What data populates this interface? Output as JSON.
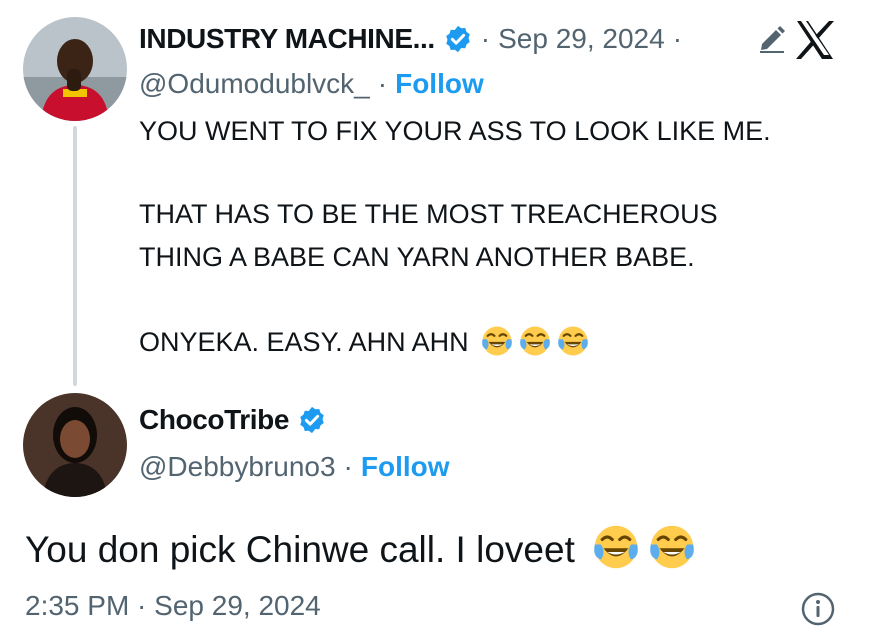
{
  "tweet1": {
    "author_name": "INDUSTRY MACHINE...",
    "handle": "@Odumodublvck_",
    "follow_label": "Follow",
    "date": "Sep 29, 2024",
    "lines": [
      "YOU WENT TO FIX YOUR ASS TO LOOK LIKE ME.",
      "THAT HAS TO BE THE MOST TREACHEROUS",
      "THING A BABE CAN YARN ANOTHER BABE.",
      "ONYEKA. EASY. AHN AHN"
    ]
  },
  "tweet2": {
    "author_name": "ChocoTribe",
    "handle": "@Debbybruno3",
    "follow_label": "Follow",
    "text": "You don pick Chinwe call. I loveet",
    "timestamp": "2:35 PM · Sep 29, 2024"
  },
  "separators": {
    "dot": "·"
  },
  "icons": {
    "verified": "verified-badge-icon",
    "edit": "edit-pencil-icon",
    "x_logo": "x-logo-icon",
    "emoji": "tears-of-joy-emoji",
    "info": "info-icon"
  },
  "colors": {
    "accent": "#1d9bf0",
    "secondary_text": "#536471",
    "primary_text": "#0f1419",
    "thread_line": "#cfd9de"
  }
}
